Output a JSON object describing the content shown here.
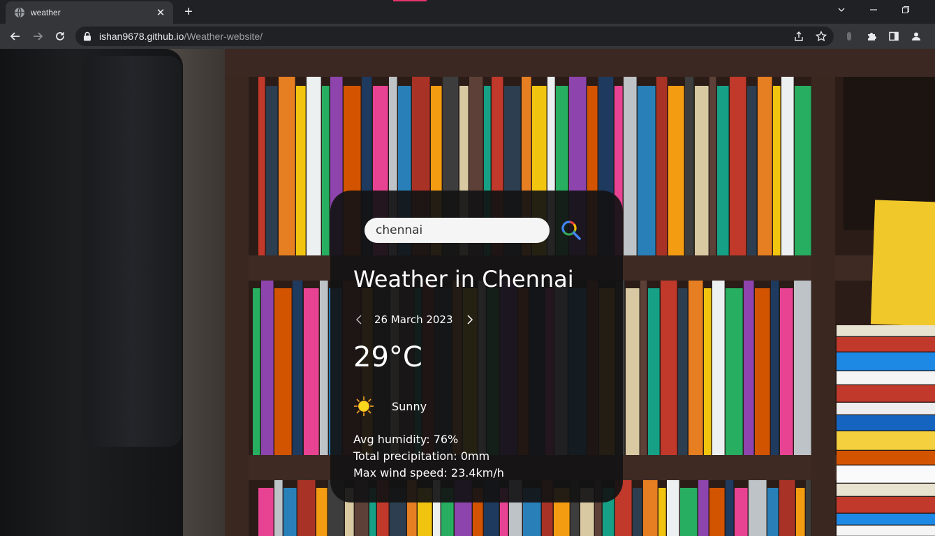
{
  "browser": {
    "tab_title": "weather",
    "url_host": "ishan9678.github.io",
    "url_path": "/Weather-website/",
    "icons": [
      "globe-icon",
      "close-icon",
      "plus-icon",
      "chevron-down-icon",
      "minimize-icon",
      "restore-icon",
      "back-icon",
      "forward-icon",
      "reload-icon",
      "lock-icon",
      "share-icon",
      "star-icon",
      "extension-icon",
      "puzzle-icon",
      "side-panel-icon",
      "profile-icon"
    ]
  },
  "weather": {
    "search_value": "chennai",
    "title": "Weather in Chennai",
    "date": "26 March 2023",
    "temperature": "29°C",
    "condition": "Sunny",
    "humidity": "Avg humidity: 76%",
    "precipitation": "Total precipitation: 0mm",
    "wind": "Max wind speed: 23.4km/h",
    "condition_icon": "sun-icon",
    "search_icon": "google-search-icon"
  },
  "colors": {
    "card_bg": "#121214",
    "chrome_bg": "#202124",
    "toolbar_bg": "#35363a",
    "sun": "#f5c518"
  }
}
